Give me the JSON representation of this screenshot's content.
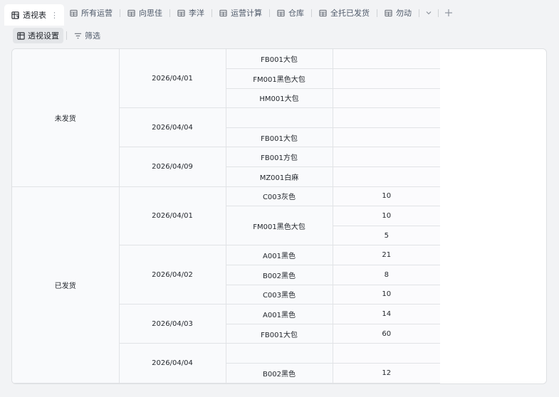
{
  "tabs": [
    {
      "label": "透视表",
      "icon": "pivot-table-icon",
      "active": true
    },
    {
      "label": "所有运营",
      "icon": "grid-table-icon"
    },
    {
      "label": "向思佳",
      "icon": "grid-table-icon"
    },
    {
      "label": "李洋",
      "icon": "grid-table-icon"
    },
    {
      "label": "运营计算",
      "icon": "grid-table-icon"
    },
    {
      "label": "仓库",
      "icon": "grid-table-icon"
    },
    {
      "label": "全托已发货",
      "icon": "grid-table-icon"
    },
    {
      "label": "勿动",
      "icon": "grid-table-icon"
    }
  ],
  "tab_controls": {
    "more_icon": "chevron-down-icon",
    "add_icon": "plus-icon"
  },
  "toolbar": {
    "pivot_settings_label": "透视设置",
    "filter_label": "筛选"
  },
  "pivot": {
    "groups": [
      {
        "status": "未发货",
        "dates": [
          {
            "date": "2026/04/01",
            "rows": [
              {
                "product": "FB001大包",
                "value": ""
              },
              {
                "product": "FM001黑色大包",
                "value": ""
              },
              {
                "product": "HM001大包",
                "value": ""
              }
            ]
          },
          {
            "date": "2026/04/04",
            "rows": [
              {
                "product": "",
                "value": ""
              },
              {
                "product": "FB001大包",
                "value": ""
              }
            ]
          },
          {
            "date": "2026/04/09",
            "rows": [
              {
                "product": "FB001方包",
                "value": ""
              },
              {
                "product": "MZ001白麻",
                "value": ""
              }
            ]
          }
        ]
      },
      {
        "status": "已发货",
        "dates": [
          {
            "date": "2026/04/01",
            "products": [
              {
                "product": "C003灰色",
                "values": [
                  "10"
                ]
              },
              {
                "product": "FM001黑色大包",
                "values": [
                  "10",
                  "5"
                ]
              }
            ]
          },
          {
            "date": "2026/04/02",
            "products": [
              {
                "product": "A001黑色",
                "values": [
                  "21"
                ]
              },
              {
                "product": "B002黑色",
                "values": [
                  "8"
                ]
              },
              {
                "product": "C003黑色",
                "values": [
                  "10"
                ]
              }
            ]
          },
          {
            "date": "2026/04/03",
            "products": [
              {
                "product": "A001黑色",
                "values": [
                  "14"
                ]
              },
              {
                "product": "FB001大包",
                "values": [
                  "60"
                ]
              }
            ]
          },
          {
            "date": "2026/04/04",
            "products": [
              {
                "product": "",
                "values": [
                  ""
                ]
              },
              {
                "product": "B002黑色",
                "values": [
                  "12"
                ]
              }
            ]
          }
        ]
      }
    ]
  }
}
